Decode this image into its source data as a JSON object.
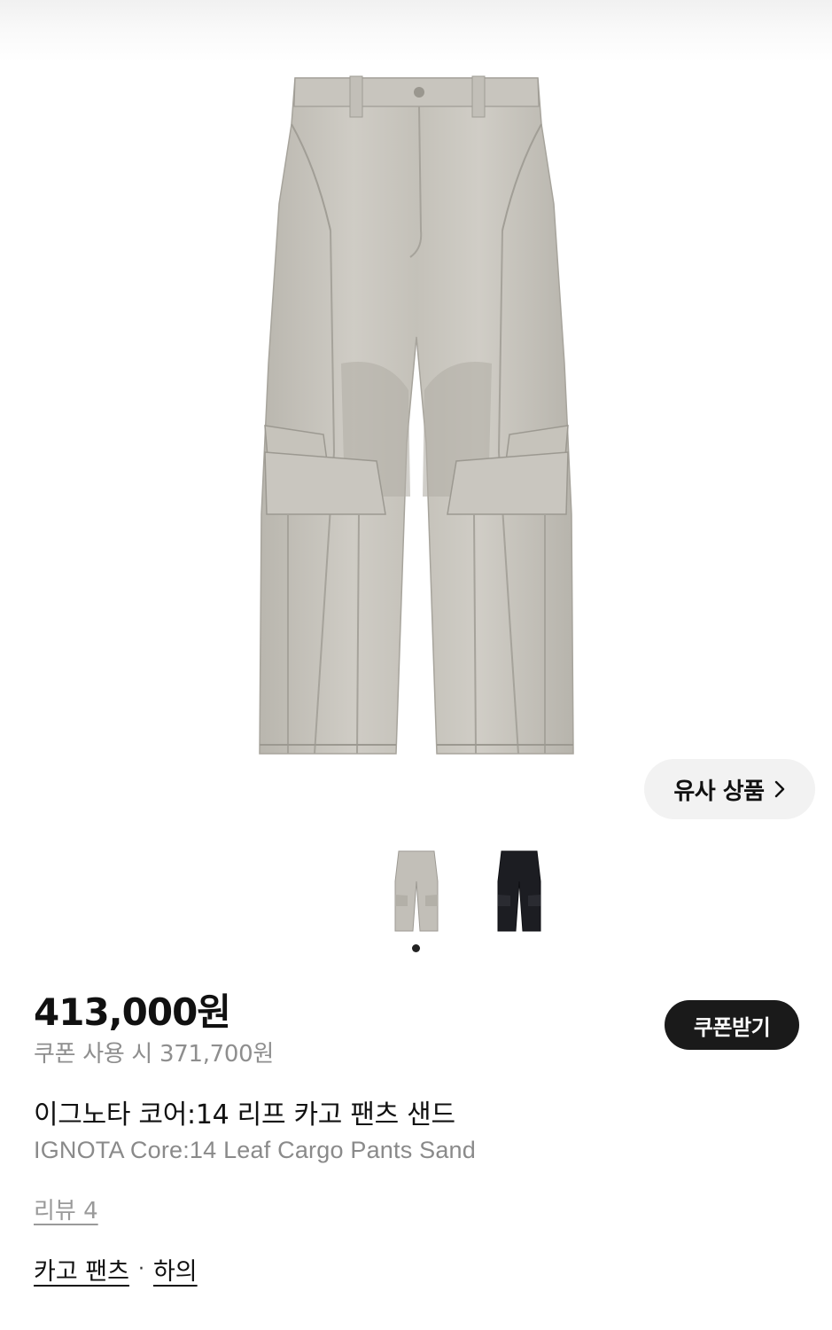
{
  "hero": {
    "image_desc": "cargo-pants-sand",
    "color": "#c9c7c0"
  },
  "similar": {
    "label": "유사 상품",
    "icon": "chevron-right-icon"
  },
  "thumbnails": [
    {
      "name": "thumb-sand",
      "color": "#bdbab3"
    },
    {
      "name": "thumb-black",
      "color": "#1c1d22"
    }
  ],
  "product": {
    "price": "413,000원",
    "coupon_price": "쿠폰 사용 시 371,700원",
    "coupon_button": "쿠폰받기",
    "name_ko": "이그노타 코어:14 리프 카고 팬츠 샌드",
    "name_en": "IGNOTA Core:14 Leaf Cargo Pants Sand",
    "review": "리뷰 4",
    "categories": [
      "카고 팬츠",
      "하의"
    ],
    "category_sep": "·"
  }
}
